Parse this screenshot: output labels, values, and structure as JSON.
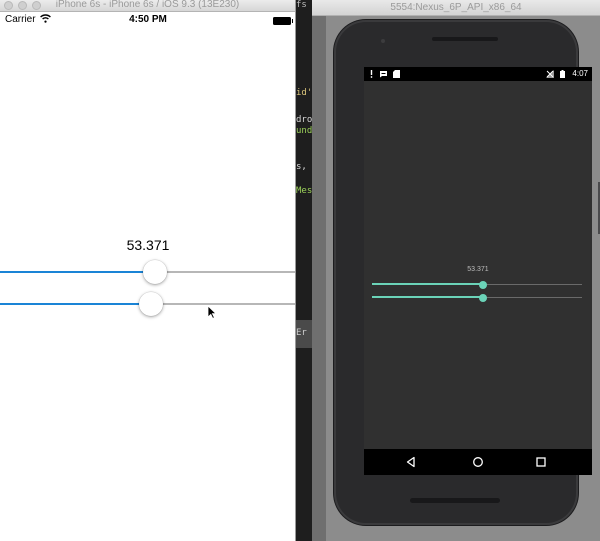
{
  "ios": {
    "window_title": "iPhone 6s - iPhone 6s / iOS 9.3 (13E230)",
    "status": {
      "carrier": "Carrier",
      "time": "4:50 PM"
    },
    "value_label": "53.371",
    "sliders": [
      {
        "name": "slider-1",
        "fraction": 0.523
      },
      {
        "name": "slider-2",
        "fraction": 0.51
      }
    ],
    "track_color": "#1a84d6"
  },
  "editor": {
    "lines": [
      "fs",
      "id'",
      "dro",
      "und",
      "s,",
      "Mes"
    ],
    "bottom_label": "Er"
  },
  "android": {
    "window_title": "5554:Nexus_6P_API_x86_64",
    "status": {
      "time": "4:07"
    },
    "value_label": "53.371",
    "sliders": [
      {
        "name": "slider-1",
        "fraction": 0.53
      },
      {
        "name": "slider-2",
        "fraction": 0.53
      }
    ],
    "accent_color": "#6bd3b8",
    "nav_icons": [
      "back-icon",
      "home-icon",
      "recents-icon"
    ]
  }
}
